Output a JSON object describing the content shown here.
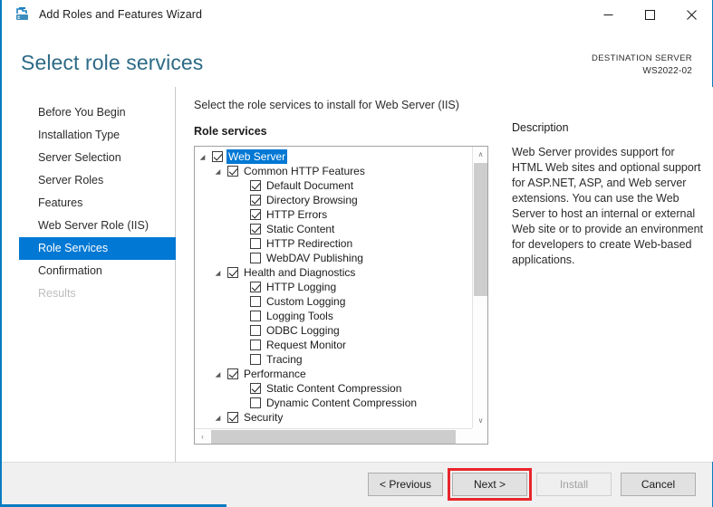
{
  "window": {
    "title": "Add Roles and Features Wizard",
    "icon": "server-roles-icon",
    "minimize_label": "—",
    "maximize_label": "□",
    "close_label": "✕"
  },
  "header": {
    "page_title": "Select role services",
    "destination_label": "DESTINATION SERVER",
    "destination_server": "WS2022-02"
  },
  "nav": {
    "items": [
      {
        "label": "Before You Begin",
        "state": "normal"
      },
      {
        "label": "Installation Type",
        "state": "normal"
      },
      {
        "label": "Server Selection",
        "state": "normal"
      },
      {
        "label": "Server Roles",
        "state": "normal"
      },
      {
        "label": "Features",
        "state": "normal"
      },
      {
        "label": "Web Server Role (IIS)",
        "state": "normal"
      },
      {
        "label": "Role Services",
        "state": "active"
      },
      {
        "label": "Confirmation",
        "state": "normal"
      },
      {
        "label": "Results",
        "state": "disabled"
      }
    ]
  },
  "main": {
    "instruction": "Select the role services to install for Web Server (IIS)",
    "section_label": "Role services",
    "tree": [
      {
        "label": "Web Server",
        "level": 0,
        "checked": true,
        "expandable": true,
        "selected": true
      },
      {
        "label": "Common HTTP Features",
        "level": 1,
        "checked": true,
        "expandable": true,
        "selected": false
      },
      {
        "label": "Default Document",
        "level": 2,
        "checked": true,
        "expandable": false,
        "selected": false
      },
      {
        "label": "Directory Browsing",
        "level": 2,
        "checked": true,
        "expandable": false,
        "selected": false
      },
      {
        "label": "HTTP Errors",
        "level": 2,
        "checked": true,
        "expandable": false,
        "selected": false
      },
      {
        "label": "Static Content",
        "level": 2,
        "checked": true,
        "expandable": false,
        "selected": false
      },
      {
        "label": "HTTP Redirection",
        "level": 2,
        "checked": false,
        "expandable": false,
        "selected": false
      },
      {
        "label": "WebDAV Publishing",
        "level": 2,
        "checked": false,
        "expandable": false,
        "selected": false
      },
      {
        "label": "Health and Diagnostics",
        "level": 1,
        "checked": true,
        "expandable": true,
        "selected": false
      },
      {
        "label": "HTTP Logging",
        "level": 2,
        "checked": true,
        "expandable": false,
        "selected": false
      },
      {
        "label": "Custom Logging",
        "level": 2,
        "checked": false,
        "expandable": false,
        "selected": false
      },
      {
        "label": "Logging Tools",
        "level": 2,
        "checked": false,
        "expandable": false,
        "selected": false
      },
      {
        "label": "ODBC Logging",
        "level": 2,
        "checked": false,
        "expandable": false,
        "selected": false
      },
      {
        "label": "Request Monitor",
        "level": 2,
        "checked": false,
        "expandable": false,
        "selected": false
      },
      {
        "label": "Tracing",
        "level": 2,
        "checked": false,
        "expandable": false,
        "selected": false
      },
      {
        "label": "Performance",
        "level": 1,
        "checked": true,
        "expandable": true,
        "selected": false
      },
      {
        "label": "Static Content Compression",
        "level": 2,
        "checked": true,
        "expandable": false,
        "selected": false
      },
      {
        "label": "Dynamic Content Compression",
        "level": 2,
        "checked": false,
        "expandable": false,
        "selected": false
      },
      {
        "label": "Security",
        "level": 1,
        "checked": true,
        "expandable": true,
        "selected": false
      }
    ],
    "scroll": {
      "up_arrow": "∧",
      "down_arrow": "∨",
      "left_arrow": "‹",
      "right_arrow": "›"
    }
  },
  "description": {
    "title": "Description",
    "body": "Web Server provides support for HTML Web sites and optional support for ASP.NET, ASP, and Web server extensions. You can use the Web Server to host an internal or external Web site or to provide an environment for developers to create Web-based applications."
  },
  "footer": {
    "previous_label": "< Previous",
    "next_label": "Next >",
    "install_label": "Install",
    "cancel_label": "Cancel"
  },
  "colors": {
    "accent": "#0078d4",
    "title_teal": "#2c6a86",
    "highlight_red": "#e8262b",
    "window_border_blue": "#0a7cc0"
  }
}
